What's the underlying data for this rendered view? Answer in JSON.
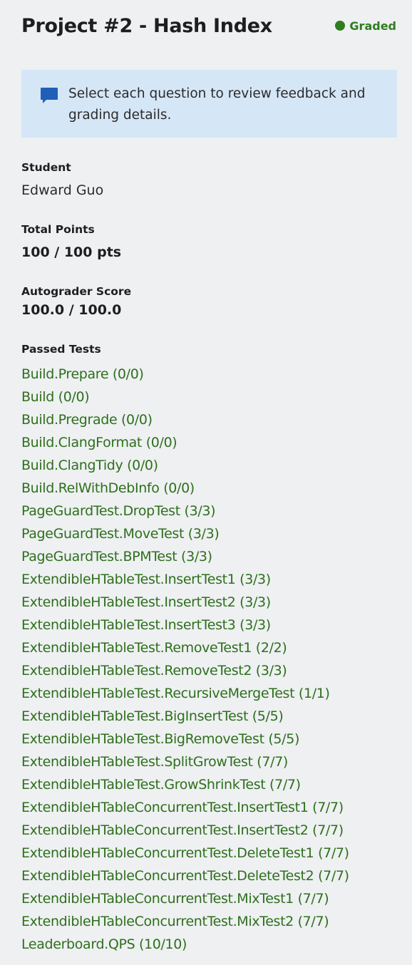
{
  "header": {
    "title": "Project #2 - Hash Index",
    "status": "Graded",
    "status_color": "#2e7d1f"
  },
  "notice": {
    "icon": "speech-bubble-icon",
    "text": "Select each question to review feedback and grading details."
  },
  "student": {
    "label": "Student",
    "name": "Edward Guo"
  },
  "total_points": {
    "label": "Total Points",
    "value": "100 / 100 pts"
  },
  "autograder": {
    "label": "Autograder Score",
    "value": "100.0 / 100.0"
  },
  "passed_tests": {
    "label": "Passed Tests",
    "link_color": "#2e6f1c",
    "items": [
      "Build.Prepare (0/0)",
      "Build (0/0)",
      "Build.Pregrade (0/0)",
      "Build.ClangFormat (0/0)",
      "Build.ClangTidy (0/0)",
      "Build.RelWithDebInfo (0/0)",
      "PageGuardTest.DropTest (3/3)",
      "PageGuardTest.MoveTest (3/3)",
      "PageGuardTest.BPMTest (3/3)",
      "ExtendibleHTableTest.InsertTest1 (3/3)",
      "ExtendibleHTableTest.InsertTest2 (3/3)",
      "ExtendibleHTableTest.InsertTest3 (3/3)",
      "ExtendibleHTableTest.RemoveTest1 (2/2)",
      "ExtendibleHTableTest.RemoveTest2 (3/3)",
      "ExtendibleHTableTest.RecursiveMergeTest (1/1)",
      "ExtendibleHTableTest.BigInsertTest (5/5)",
      "ExtendibleHTableTest.BigRemoveTest (5/5)",
      "ExtendibleHTableTest.SplitGrowTest (7/7)",
      "ExtendibleHTableTest.GrowShrinkTest (7/7)",
      "ExtendibleHTableConcurrentTest.InsertTest1 (7/7)",
      "ExtendibleHTableConcurrentTest.InsertTest2 (7/7)",
      "ExtendibleHTableConcurrentTest.DeleteTest1 (7/7)",
      "ExtendibleHTableConcurrentTest.DeleteTest2 (7/7)",
      "ExtendibleHTableConcurrentTest.MixTest1 (7/7)",
      "ExtendibleHTableConcurrentTest.MixTest2 (7/7)",
      "Leaderboard.QPS (10/10)"
    ]
  }
}
